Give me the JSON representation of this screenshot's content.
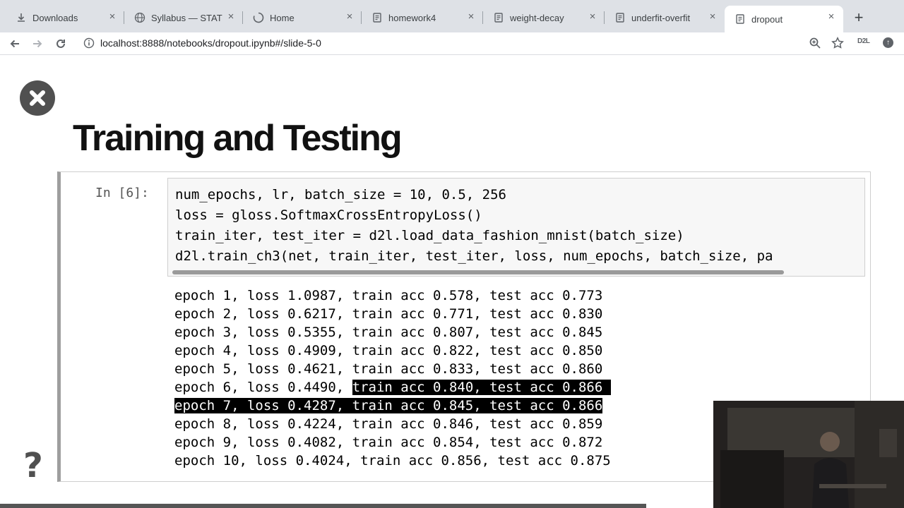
{
  "tabs": [
    {
      "label": "Downloads",
      "icon": "download-icon"
    },
    {
      "label": "Syllabus — STAT",
      "icon": "globe-icon"
    },
    {
      "label": "Home",
      "icon": "spinner-icon"
    },
    {
      "label": "homework4",
      "icon": "notebook-icon"
    },
    {
      "label": "weight-decay",
      "icon": "notebook-icon"
    },
    {
      "label": "underfit-overfit",
      "icon": "notebook-icon"
    },
    {
      "label": "dropout",
      "icon": "notebook-icon",
      "active": true
    }
  ],
  "address_bar": {
    "url": "localhost:8888/notebooks/dropout.ipynb#/slide-5-0"
  },
  "extensions": {
    "d2l_label": "D2L"
  },
  "slide": {
    "title": "Training and Testing",
    "help_symbol": "?"
  },
  "cell": {
    "prompt": "In [6]:",
    "code_lines": [
      "num_epochs, lr, batch_size = 10, 0.5, 256",
      "loss = gloss.SoftmaxCrossEntropyLoss()",
      "train_iter, test_iter = d2l.load_data_fashion_mnist(batch_size)",
      "d2l.train_ch3(net, train_iter, test_iter, loss, num_epochs, batch_size, pa"
    ],
    "output_lines": [
      "epoch 1, loss 1.0987, train acc 0.578, test acc 0.773",
      "epoch 2, loss 0.6217, train acc 0.771, test acc 0.830",
      "epoch 3, loss 0.5355, train acc 0.807, test acc 0.845",
      "epoch 4, loss 0.4909, train acc 0.822, test acc 0.850",
      "epoch 5, loss 0.4621, train acc 0.833, test acc 0.860",
      "epoch 6, loss 0.4490, train acc 0.840, test acc 0.866",
      "epoch 7, loss 0.4287, train acc 0.845, test acc 0.866",
      "epoch 8, loss 0.4224, train acc 0.846, test acc 0.859",
      "epoch 9, loss 0.4082, train acc 0.854, test acc 0.872",
      "epoch 10, loss 0.4024, train acc 0.856, test acc 0.875"
    ],
    "epoch6_prefix": "epoch 6, loss 0.4490, ",
    "epoch6_selected": "train acc 0.840, test acc 0.866 "
  }
}
